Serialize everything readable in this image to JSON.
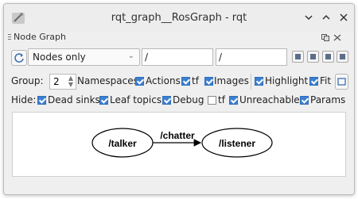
{
  "window": {
    "title": "rqt_graph__RosGraph - rqt"
  },
  "dock": {
    "title": "Node Graph"
  },
  "toolbar": {
    "mode_value": "Nodes only",
    "namespace_filter": "/",
    "topic_filter": "/"
  },
  "options": {
    "group_label": "Group:",
    "group_value": "2",
    "namespaces_label": "Namespaces",
    "actions_label": "Actions",
    "tf_label": "tf",
    "images_label": "Images",
    "highlight_label": "Highlight",
    "fit_label": "Fit"
  },
  "hide": {
    "label": "Hide:",
    "dead_sinks_label": "Dead sinks",
    "leaf_topics_label": "Leaf topics",
    "debug_label": "Debug",
    "tf_label": "tf",
    "unreachable_label": "Unreachable",
    "params_label": "Params"
  },
  "checks": {
    "actions": true,
    "tf": true,
    "images": true,
    "highlight": true,
    "fit": true,
    "dead_sinks": true,
    "leaf_topics": true,
    "debug": true,
    "hide_tf": false,
    "unreachable": true,
    "params": true
  },
  "graph": {
    "node_source": "/talker",
    "edge_label": "/chatter",
    "node_target": "/listener"
  },
  "colors": {
    "accent": "#3d7fcf"
  }
}
